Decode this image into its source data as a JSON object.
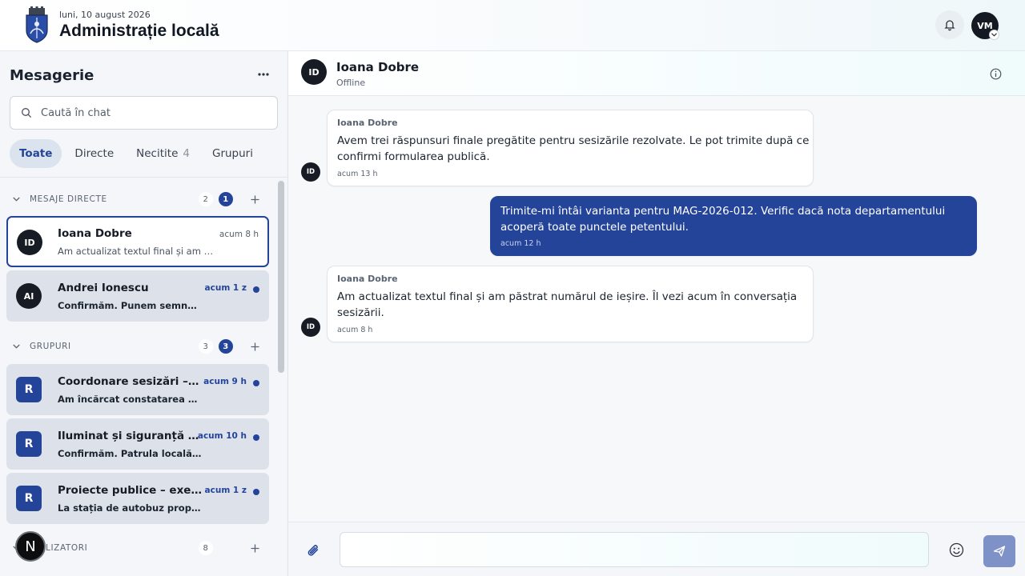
{
  "header": {
    "date": "luni, 10 august 2026",
    "title": "Administrație locală",
    "user_initials": "VM"
  },
  "sidebar": {
    "title": "Mesagerie",
    "search_placeholder": "Caută în chat",
    "tabs": [
      {
        "label": "Toate",
        "count": "",
        "active": true
      },
      {
        "label": "Directe",
        "count": ""
      },
      {
        "label": "Necitite",
        "count": "4"
      },
      {
        "label": "Grupuri",
        "count": ""
      }
    ],
    "sections": {
      "direct": {
        "label": "MESAJE DIRECTE",
        "count": "2",
        "unread": "1"
      },
      "groups": {
        "label": "GRUPURI",
        "count": "3",
        "unread": "3"
      },
      "users": {
        "label": "LIZATORI",
        "count": "8"
      }
    },
    "direct_chats": [
      {
        "initials": "ID",
        "name": "Ioana Dobre",
        "time": "acum 8 h",
        "preview": "Am actualizat textul final și am p...",
        "selected": true
      },
      {
        "initials": "AI",
        "name": "Andrei Ionescu",
        "time": "acum 1 z",
        "preview": "Confirmăm. Punem semnaliz...",
        "unread": true
      }
    ],
    "group_chats": [
      {
        "initials": "R",
        "name": "Coordonare sesizări – o...",
        "time": "acum 9 h",
        "preview": "Am încărcat constatarea pen...",
        "unread": true
      },
      {
        "initials": "R",
        "name": "Iluminat și siguranță r...",
        "time": "acum 10 h",
        "preview": "Confirmăm. Patrula locală ...",
        "unread": true
      },
      {
        "initials": "R",
        "name": "Proiecte publice – execu...",
        "time": "acum 1 z",
        "preview": "La stația de autobuz propun...",
        "unread": true
      }
    ],
    "fab_label": "N"
  },
  "conversation": {
    "initials": "ID",
    "name": "Ioana Dobre",
    "status": "Offline",
    "messages": [
      {
        "sender": "Ioana Dobre",
        "line1": "Avem trei răspunsuri finale pregătite pentru sesizările rezolvate. Le pot trimite după ce",
        "line2": "confirmi formularea publică.",
        "time": "acum 13 h"
      },
      {
        "sender": "",
        "line1": "Trimite-mi întâi varianta pentru MAG-2026-012. Verific dacă nota departamentului",
        "line2": "acoperă toate punctele petentului.",
        "time": "acum 12 h"
      },
      {
        "sender": "Ioana Dobre",
        "line1": "Am actualizat textul final și am păstrat numărul de ieșire. Îl vezi acum în conversația",
        "line2": "sesizării.",
        "time": "acum 8 h"
      }
    ],
    "composer_placeholder": ""
  },
  "icons": {
    "crest": "city-crest-icon",
    "notifications": "bell-icon",
    "more": "more-horizontal-icon",
    "search": "search-icon",
    "info": "info-icon",
    "attach": "paperclip-icon",
    "emoji": "emoji-icon",
    "send": "send-icon"
  },
  "colors": {
    "accent": "#24449a",
    "send_disabled": "#7f92c7"
  }
}
